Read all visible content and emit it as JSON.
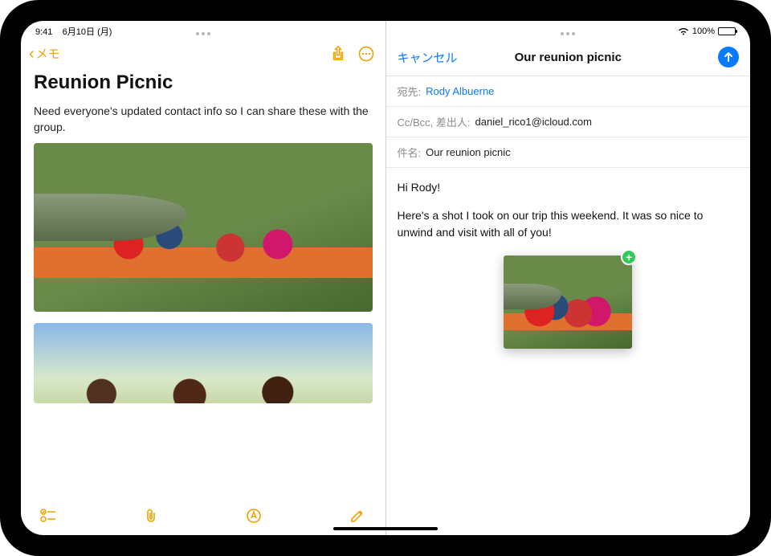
{
  "status": {
    "time": "9:41",
    "date": "6月10日 (月)",
    "battery_pct": "100%"
  },
  "notes": {
    "back_label": "メモ",
    "title": "Reunion Picnic",
    "body_text": "Need everyone's updated contact info so I can share these with the group."
  },
  "mail": {
    "cancel_label": "キャンセル",
    "title": "Our reunion picnic",
    "to_label": "宛先:",
    "to_value": "Rody Albuerne",
    "cc_label": "Cc/Bcc, 差出人:",
    "cc_value": "daniel_rico1@icloud.com",
    "subject_label": "件名:",
    "subject_value": "Our reunion picnic",
    "greeting": "Hi Rody!",
    "body": "Here's a shot I took on our trip this weekend. It was so nice to unwind and visit with all of you!"
  }
}
